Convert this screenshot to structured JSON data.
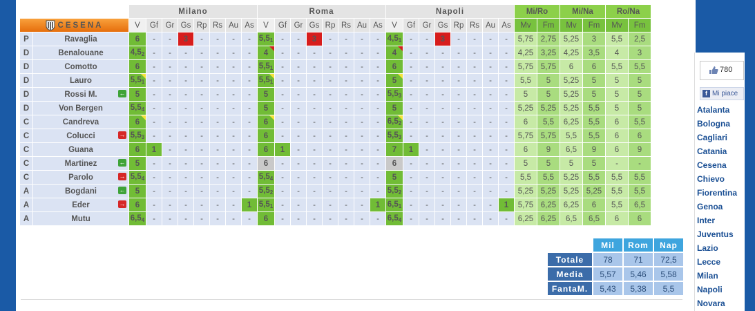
{
  "team": {
    "name": "CESENA"
  },
  "matches": [
    "Milano",
    "Roma",
    "Napoli"
  ],
  "stat_cols": [
    "V",
    "Gf",
    "Gr",
    "Gs",
    "Rp",
    "Rs",
    "Au",
    "As"
  ],
  "compare": {
    "groups": [
      "Mi/Ro",
      "Mi/Na",
      "Ro/Na"
    ],
    "cols": [
      "Mv",
      "Fm",
      "Mv",
      "Fm",
      "Mv",
      "Fm"
    ]
  },
  "players": [
    {
      "role": "P",
      "name": "Ravaglia",
      "sub": "",
      "m": [
        {
          "v": "6",
          "vd": "",
          "tri": "",
          "c": [
            "-",
            "-",
            "3",
            "-",
            "-",
            "-",
            "-"
          ],
          "hl": {
            "2": "gs"
          }
        },
        {
          "v": "5,5",
          "vd": "1",
          "tri": "",
          "c": [
            "-",
            "-",
            "3",
            "-",
            "-",
            "-",
            "-"
          ],
          "hl": {
            "2": "gs"
          }
        },
        {
          "v": "4,5",
          "vd": "1",
          "tri": "",
          "c": [
            "-",
            "-",
            "3",
            "-",
            "-",
            "-",
            "-"
          ],
          "hl": {
            "2": "gs"
          }
        }
      ],
      "cmp": [
        "5,75",
        "2,75",
        "5,25",
        "3",
        "5,5",
        "2,5"
      ]
    },
    {
      "role": "D",
      "name": "Benalouane",
      "sub": "",
      "m": [
        {
          "v": "4,5",
          "vd": "2",
          "tri": "",
          "c": [
            "-",
            "-",
            "-",
            "-",
            "-",
            "-",
            "-"
          ]
        },
        {
          "v": "4",
          "vd": "",
          "tri": "r",
          "c": [
            "-",
            "-",
            "-",
            "-",
            "-",
            "-",
            "-"
          ]
        },
        {
          "v": "4",
          "vd": "",
          "tri": "r",
          "c": [
            "-",
            "-",
            "-",
            "-",
            "-",
            "-",
            "-"
          ]
        }
      ],
      "cmp": [
        "4,25",
        "3,25",
        "4,25",
        "3,5",
        "4",
        "3"
      ]
    },
    {
      "role": "D",
      "name": "Comotto",
      "sub": "",
      "m": [
        {
          "v": "6",
          "vd": "",
          "tri": "",
          "c": [
            "-",
            "-",
            "-",
            "-",
            "-",
            "-",
            "-"
          ]
        },
        {
          "v": "5,5",
          "vd": "1",
          "tri": "",
          "c": [
            "-",
            "-",
            "-",
            "-",
            "-",
            "-",
            "-"
          ]
        },
        {
          "v": "6",
          "vd": "",
          "tri": "",
          "c": [
            "-",
            "-",
            "-",
            "-",
            "-",
            "-",
            "-"
          ]
        }
      ],
      "cmp": [
        "5,75",
        "5,75",
        "6",
        "6",
        "5,5",
        "5,5"
      ]
    },
    {
      "role": "D",
      "name": "Lauro",
      "sub": "",
      "m": [
        {
          "v": "5,5",
          "vd": "1",
          "tri": "y",
          "c": [
            "-",
            "-",
            "-",
            "-",
            "-",
            "-",
            "-"
          ]
        },
        {
          "v": "5,5",
          "vd": "1",
          "tri": "y",
          "c": [
            "-",
            "-",
            "-",
            "-",
            "-",
            "-",
            "-"
          ]
        },
        {
          "v": "5",
          "vd": "",
          "tri": "y",
          "c": [
            "-",
            "-",
            "-",
            "-",
            "-",
            "-",
            "-"
          ]
        }
      ],
      "cmp": [
        "5,5",
        "5",
        "5,25",
        "5",
        "5",
        "5"
      ]
    },
    {
      "role": "D",
      "name": "Rossi M.",
      "sub": "in",
      "m": [
        {
          "v": "5",
          "vd": "",
          "tri": "",
          "c": [
            "-",
            "-",
            "-",
            "-",
            "-",
            "-",
            "-"
          ]
        },
        {
          "v": "5",
          "vd": "",
          "tri": "",
          "c": [
            "-",
            "-",
            "-",
            "-",
            "-",
            "-",
            "-"
          ]
        },
        {
          "v": "5,5",
          "vd": "3",
          "tri": "",
          "c": [
            "-",
            "-",
            "-",
            "-",
            "-",
            "-",
            "-"
          ]
        }
      ],
      "cmp": [
        "5",
        "5",
        "5,25",
        "5",
        "5",
        "5"
      ]
    },
    {
      "role": "D",
      "name": "Von Bergen",
      "sub": "",
      "m": [
        {
          "v": "5,5",
          "vd": "4",
          "tri": "",
          "c": [
            "-",
            "-",
            "-",
            "-",
            "-",
            "-",
            "-"
          ]
        },
        {
          "v": "5",
          "vd": "",
          "tri": "",
          "c": [
            "-",
            "-",
            "-",
            "-",
            "-",
            "-",
            "-"
          ]
        },
        {
          "v": "5",
          "vd": "",
          "tri": "",
          "c": [
            "-",
            "-",
            "-",
            "-",
            "-",
            "-",
            "-"
          ]
        }
      ],
      "cmp": [
        "5,25",
        "5,25",
        "5,25",
        "5,5",
        "5",
        "5"
      ]
    },
    {
      "role": "C",
      "name": "Candreva",
      "sub": "",
      "m": [
        {
          "v": "6",
          "vd": "",
          "tri": "y",
          "c": [
            "-",
            "-",
            "-",
            "-",
            "-",
            "-",
            "-"
          ]
        },
        {
          "v": "6",
          "vd": "",
          "tri": "y",
          "c": [
            "-",
            "-",
            "-",
            "-",
            "-",
            "-",
            "-"
          ]
        },
        {
          "v": "6,5",
          "vd": "2",
          "tri": "y",
          "c": [
            "-",
            "-",
            "-",
            "-",
            "-",
            "-",
            "-"
          ]
        }
      ],
      "cmp": [
        "6",
        "5,5",
        "6,25",
        "5,5",
        "6",
        "5,5"
      ]
    },
    {
      "role": "C",
      "name": "Colucci",
      "sub": "out",
      "m": [
        {
          "v": "5,5",
          "vd": "3",
          "tri": "",
          "c": [
            "-",
            "-",
            "-",
            "-",
            "-",
            "-",
            "-"
          ]
        },
        {
          "v": "6",
          "vd": "",
          "tri": "",
          "c": [
            "-",
            "-",
            "-",
            "-",
            "-",
            "-",
            "-"
          ]
        },
        {
          "v": "5,5",
          "vd": "3",
          "tri": "",
          "c": [
            "-",
            "-",
            "-",
            "-",
            "-",
            "-",
            "-"
          ]
        }
      ],
      "cmp": [
        "5,75",
        "5,75",
        "5,5",
        "5,5",
        "6",
        "6"
      ]
    },
    {
      "role": "C",
      "name": "Guana",
      "sub": "",
      "m": [
        {
          "v": "6",
          "vd": "",
          "tri": "",
          "c": [
            "1",
            "-",
            "-",
            "-",
            "-",
            "-",
            "-"
          ],
          "hl": {
            "0": "g"
          }
        },
        {
          "v": "6",
          "vd": "",
          "tri": "",
          "c": [
            "1",
            "-",
            "-",
            "-",
            "-",
            "-",
            "-"
          ],
          "hl": {
            "0": "g"
          }
        },
        {
          "v": "7",
          "vd": "",
          "tri": "",
          "c": [
            "1",
            "-",
            "-",
            "-",
            "-",
            "-",
            "-"
          ],
          "hl": {
            "0": "g"
          }
        }
      ],
      "cmp": [
        "6",
        "9",
        "6,5",
        "9",
        "6",
        "9"
      ]
    },
    {
      "role": "C",
      "name": "Martinez",
      "sub": "in",
      "m": [
        {
          "v": "5",
          "vd": "",
          "tri": "",
          "c": [
            "-",
            "-",
            "-",
            "-",
            "-",
            "-",
            "-"
          ]
        },
        {
          "v": "6",
          "vd": "",
          "tri": "",
          "na": true,
          "c": [
            "-",
            "-",
            "-",
            "-",
            "-",
            "-",
            "-"
          ]
        },
        {
          "v": "6",
          "vd": "",
          "tri": "",
          "na": true,
          "c": [
            "-",
            "-",
            "-",
            "-",
            "-",
            "-",
            "-"
          ]
        }
      ],
      "cmp": [
        "5",
        "5",
        "5",
        "5",
        "-",
        "-"
      ]
    },
    {
      "role": "C",
      "name": "Parolo",
      "sub": "out",
      "m": [
        {
          "v": "5,5",
          "vd": "4",
          "tri": "",
          "c": [
            "-",
            "-",
            "-",
            "-",
            "-",
            "-",
            "-"
          ]
        },
        {
          "v": "5,5",
          "vd": "4",
          "tri": "",
          "c": [
            "-",
            "-",
            "-",
            "-",
            "-",
            "-",
            "-"
          ]
        },
        {
          "v": "5",
          "vd": "",
          "tri": "",
          "c": [
            "-",
            "-",
            "-",
            "-",
            "-",
            "-",
            "-"
          ]
        }
      ],
      "cmp": [
        "5,5",
        "5,5",
        "5,25",
        "5,5",
        "5,5",
        "5,5"
      ]
    },
    {
      "role": "A",
      "name": "Bogdani",
      "sub": "in",
      "m": [
        {
          "v": "5",
          "vd": "",
          "tri": "",
          "c": [
            "-",
            "-",
            "-",
            "-",
            "-",
            "-",
            "-"
          ]
        },
        {
          "v": "5,5",
          "vd": "2",
          "tri": "",
          "c": [
            "-",
            "-",
            "-",
            "-",
            "-",
            "-",
            "-"
          ]
        },
        {
          "v": "5,5",
          "vd": "2",
          "tri": "",
          "c": [
            "-",
            "-",
            "-",
            "-",
            "-",
            "-",
            "-"
          ]
        }
      ],
      "cmp": [
        "5,25",
        "5,25",
        "5,25",
        "5,25",
        "5,5",
        "5,5"
      ]
    },
    {
      "role": "A",
      "name": "Eder",
      "sub": "out",
      "m": [
        {
          "v": "6",
          "vd": "",
          "tri": "",
          "c": [
            "-",
            "-",
            "-",
            "-",
            "-",
            "-",
            "1"
          ],
          "hl": {
            "6": "g"
          }
        },
        {
          "v": "5,5",
          "vd": "1",
          "tri": "",
          "c": [
            "-",
            "-",
            "-",
            "-",
            "-",
            "-",
            "1"
          ],
          "hl": {
            "6": "g"
          }
        },
        {
          "v": "6,5",
          "vd": "1",
          "tri": "",
          "c": [
            "-",
            "-",
            "-",
            "-",
            "-",
            "-",
            "1"
          ],
          "hl": {
            "6": "g"
          }
        }
      ],
      "cmp": [
        "5,75",
        "6,25",
        "6,25",
        "6",
        "5,5",
        "6,5"
      ]
    },
    {
      "role": "A",
      "name": "Mutu",
      "sub": "",
      "m": [
        {
          "v": "6,5",
          "vd": "4",
          "tri": "",
          "c": [
            "-",
            "-",
            "-",
            "-",
            "-",
            "-",
            "-"
          ]
        },
        {
          "v": "6",
          "vd": "",
          "tri": "",
          "c": [
            "-",
            "-",
            "-",
            "-",
            "-",
            "-",
            "-"
          ]
        },
        {
          "v": "6,5",
          "vd": "4",
          "tri": "",
          "c": [
            "-",
            "-",
            "-",
            "-",
            "-",
            "-",
            "-"
          ]
        }
      ],
      "cmp": [
        "6,25",
        "6,25",
        "6,5",
        "6,5",
        "6",
        "6"
      ]
    }
  ],
  "totals": {
    "headers": [
      "Mil",
      "Rom",
      "Nap"
    ],
    "rows": [
      {
        "label": "Totale",
        "values": [
          "78",
          "71",
          "72,5"
        ]
      },
      {
        "label": "Media",
        "values": [
          "5,57",
          "5,46",
          "5,58"
        ]
      },
      {
        "label": "FantaM.",
        "values": [
          "5,43",
          "5,38",
          "5,5"
        ]
      }
    ]
  },
  "social": {
    "like_count": "780",
    "like_label": "Mi piace"
  },
  "team_links": [
    "Atalanta",
    "Bologna",
    "Cagliari",
    "Catania",
    "Cesena",
    "Chievo",
    "Fiorentina",
    "Genoa",
    "Inter",
    "Juventus",
    "Lazio",
    "Lecce",
    "Milan",
    "Napoli",
    "Novara"
  ],
  "colors": {
    "vote_green": "#71bc36",
    "goal_conceded_red": "#d71d1d",
    "header_orange": "#f08a24",
    "compare_green": "#8cd04a",
    "totals_blue": "#3b6ca9",
    "background_blue": "#1a5aa6"
  }
}
